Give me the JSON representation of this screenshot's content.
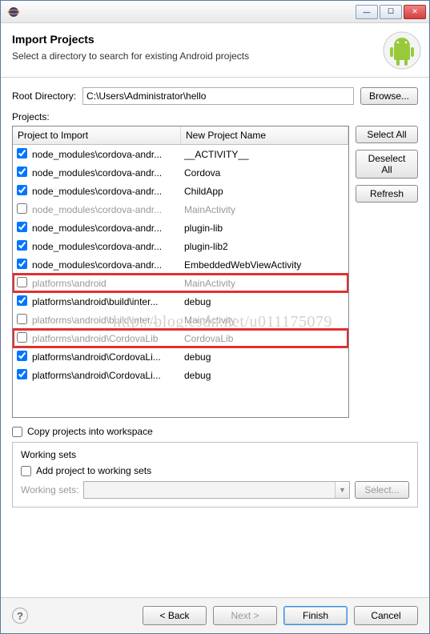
{
  "titlebar": {
    "min": "—",
    "max": "☐",
    "close": "✕"
  },
  "header": {
    "title": "Import Projects",
    "subtitle": "Select a directory to search for existing Android projects"
  },
  "root": {
    "label": "Root Directory:",
    "value": "C:\\Users\\Administrator\\hello",
    "browse": "Browse..."
  },
  "projectsLabel": "Projects:",
  "columns": {
    "c1": "Project to Import",
    "c2": "New Project Name"
  },
  "sideButtons": {
    "selectAll": "Select All",
    "deselectAll": "Deselect All",
    "refresh": "Refresh"
  },
  "rows": [
    {
      "checked": true,
      "greyed": false,
      "hl": false,
      "path": "node_modules\\cordova-andr...",
      "name": "__ACTIVITY__"
    },
    {
      "checked": true,
      "greyed": false,
      "hl": false,
      "path": "node_modules\\cordova-andr...",
      "name": "Cordova"
    },
    {
      "checked": true,
      "greyed": false,
      "hl": false,
      "path": "node_modules\\cordova-andr...",
      "name": "ChildApp"
    },
    {
      "checked": false,
      "greyed": true,
      "hl": false,
      "path": "node_modules\\cordova-andr...",
      "name": "MainActivity"
    },
    {
      "checked": true,
      "greyed": false,
      "hl": false,
      "path": "node_modules\\cordova-andr...",
      "name": "plugin-lib"
    },
    {
      "checked": true,
      "greyed": false,
      "hl": false,
      "path": "node_modules\\cordova-andr...",
      "name": "plugin-lib2"
    },
    {
      "checked": true,
      "greyed": false,
      "hl": false,
      "path": "node_modules\\cordova-andr...",
      "name": "EmbeddedWebViewActivity"
    },
    {
      "checked": false,
      "greyed": true,
      "hl": true,
      "path": "platforms\\android",
      "name": "MainActivity"
    },
    {
      "checked": true,
      "greyed": false,
      "hl": false,
      "path": "platforms\\android\\build\\inter...",
      "name": "debug"
    },
    {
      "checked": false,
      "greyed": true,
      "hl": false,
      "path": "platforms\\android\\build\\inter...",
      "name": "MainActivity"
    },
    {
      "checked": false,
      "greyed": true,
      "hl": true,
      "path": "platforms\\android\\CordovaLib",
      "name": "CordovaLib"
    },
    {
      "checked": true,
      "greyed": false,
      "hl": false,
      "path": "platforms\\android\\CordovaLi...",
      "name": "debug"
    },
    {
      "checked": true,
      "greyed": false,
      "hl": false,
      "path": "platforms\\android\\CordovaLi...",
      "name": "debug"
    }
  ],
  "copyIntoWs": {
    "checked": false,
    "label": "Copy projects into workspace"
  },
  "workingSets": {
    "legend": "Working sets",
    "add": {
      "checked": false,
      "label": "Add project to working sets"
    },
    "comboLabel": "Working sets:",
    "select": "Select..."
  },
  "footer": {
    "back": "< Back",
    "next": "Next >",
    "finish": "Finish",
    "cancel": "Cancel"
  },
  "watermark": "http://blog.csdn.net/u011175079"
}
